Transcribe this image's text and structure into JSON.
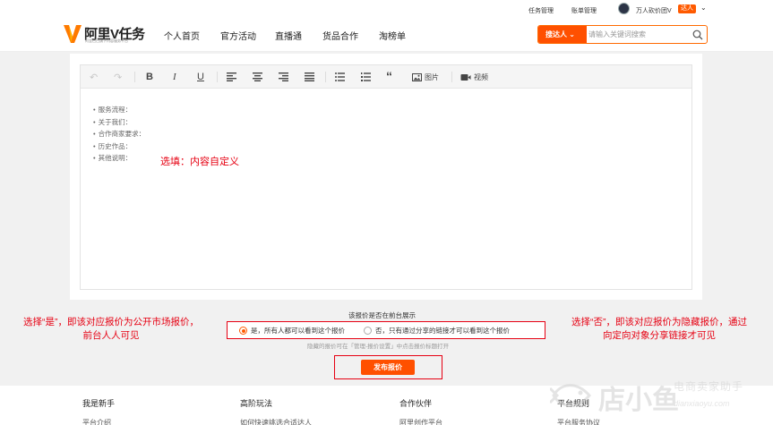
{
  "top_bar": {
    "task_manage": "任务管理",
    "bill_manage": "账单管理",
    "username": "万人砍价团V",
    "badge": "达人"
  },
  "header": {
    "logo_name": "阿里V任务",
    "logo_sub": "阿里巴巴旗下内容服务平台",
    "nav": [
      "个人首页",
      "官方活动",
      "直播通",
      "货品合作",
      "淘榜单"
    ],
    "search": {
      "scope": "搜达人",
      "placeholder": "请输入关键词搜索"
    }
  },
  "editor": {
    "toolbar": {
      "image_label": "图片",
      "video_label": "视频"
    },
    "content_items": [
      "服务流程：",
      "关于我们：",
      "合作商家要求：",
      "历史作品：",
      "其他说明："
    ],
    "hint": "选填：内容自定义"
  },
  "quote_display": {
    "title": "该报价是否在前台展示",
    "option_yes": "是，所有人都可以看到这个报价",
    "option_no": "否，只有通过分享的链接才可以看到这个报价",
    "selected": "yes",
    "note": "隐藏的报价可在「管理-报价设置」中点击报价标题打开",
    "left_annotation_l1": "选择“是”，即该对应报价为公开市场报价，",
    "left_annotation_l2": "前台人人可见",
    "right_annotation_l1": "选择“否”，即该对应报价为隐藏报价，通过",
    "right_annotation_l2": "向定向对象分享链接才可见",
    "publish_button": "发布报价"
  },
  "footer": {
    "columns": [
      {
        "heading": "我是新手",
        "item": "平台介绍"
      },
      {
        "heading": "高阶玩法",
        "item": "如何快速挑选合适达人"
      },
      {
        "heading": "合作伙伴",
        "item": "阿里创作平台"
      },
      {
        "heading": "平台规则",
        "item": "平台服务协议"
      }
    ]
  },
  "watermark": {
    "brand": "店小鱼",
    "tagline": "电商卖家助手",
    "url": "dianxiaoyu.com"
  },
  "colors": {
    "accent": "#ff5000",
    "annotation": "#e60012"
  }
}
